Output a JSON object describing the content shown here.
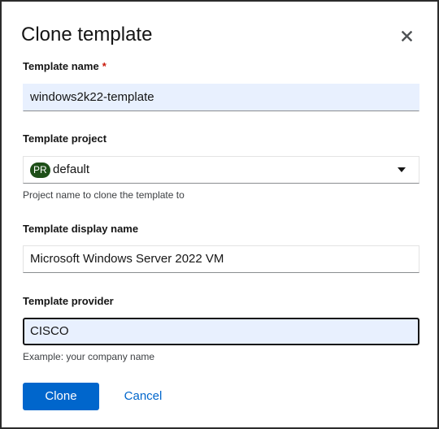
{
  "modal": {
    "title": "Clone template",
    "close_icon": "close-icon"
  },
  "fields": {
    "template_name": {
      "label": "Template name",
      "required_marker": "*",
      "value": "windows2k22-template"
    },
    "template_project": {
      "label": "Template project",
      "badge": "PR",
      "value": "default",
      "helper": "Project name to clone the template to"
    },
    "template_display_name": {
      "label": "Template display name",
      "value": "Microsoft Windows Server 2022 VM"
    },
    "template_provider": {
      "label": "Template provider",
      "value": "CISCO",
      "helper": "Example: your company name"
    }
  },
  "actions": {
    "clone_label": "Clone",
    "cancel_label": "Cancel"
  },
  "colors": {
    "primary": "#0066cc",
    "required": "#c9190b",
    "project_badge": "#1e4f18",
    "autofill_background": "#e8f0fe"
  }
}
